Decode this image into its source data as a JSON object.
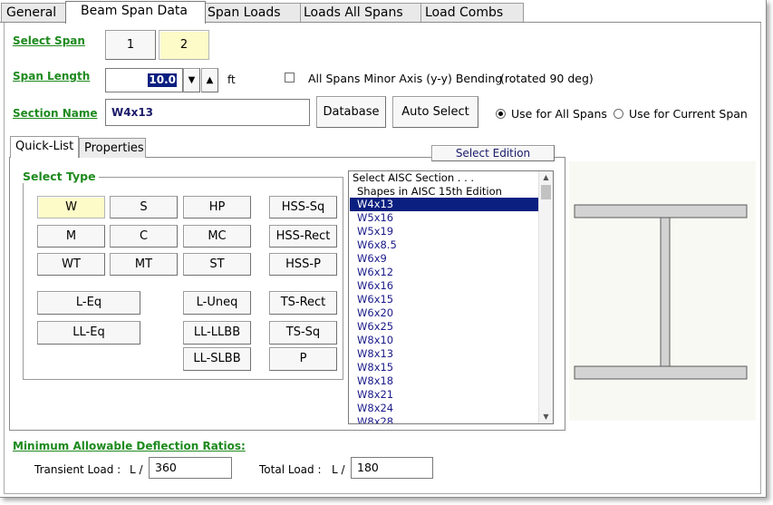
{
  "tabs": [
    {
      "label": "General"
    },
    {
      "label": "Beam Span Data"
    },
    {
      "label": "Span Loads"
    },
    {
      "label": "Loads All Spans"
    },
    {
      "label": "Load Combs"
    }
  ],
  "span": {
    "label": "Select Span",
    "buttons": [
      "1",
      "2"
    ],
    "selected": "2"
  },
  "span_length": {
    "label": "Span Length",
    "value": "10.0",
    "unit": "ft",
    "down_arrow": "▼",
    "up_arrow": "▲"
  },
  "minor_axis": {
    "label": "All Spans Minor Axis (y-y) Bending",
    "note": "(rotated 90 deg)",
    "checked": false
  },
  "section": {
    "label": "Section Name",
    "value": "W4x13",
    "database_label": "Database",
    "auto_select_label": "Auto Select",
    "radio_all": "Use for All Spans",
    "radio_current": "Use for Current Span",
    "radio_selected": "all"
  },
  "inner_tabs": [
    {
      "label": "Quick-List"
    },
    {
      "label": "Properties"
    }
  ],
  "select_edition_label": "Select Edition",
  "select_type": {
    "label": "Select Type",
    "buttons": {
      "W": "W",
      "S": "S",
      "HP": "HP",
      "HSSSq": "HSS-Sq",
      "M": "M",
      "C": "C",
      "MC": "MC",
      "HSSRect": "HSS-Rect",
      "WT": "WT",
      "MT": "MT",
      "ST": "ST",
      "HSSP": "HSS-P",
      "LEq": "L-Eq",
      "LUneq": "L-Uneq",
      "TSRect": "TS-Rect",
      "LLEq": "LL-Eq",
      "LLLLBB": "LL-LLBB",
      "TSSq": "TS-Sq",
      "LLSLBB": "LL-SLBB",
      "P": "P"
    },
    "selected": "W"
  },
  "section_list": {
    "items": [
      "Select AISC Section . . .",
      "Shapes in AISC 15th Edition",
      "W4x13",
      "W5x16",
      "W5x19",
      "W6x8.5",
      "W6x9",
      "W6x12",
      "W6x16",
      "W6x15",
      "W6x20",
      "W6x25",
      "W8x10",
      "W8x13",
      "W8x15",
      "W8x18",
      "W8x21",
      "W8x24",
      "W8x28"
    ],
    "selected": "W4x13",
    "scroll_up": "▲",
    "scroll_down": "▼"
  },
  "deflection": {
    "label": "Minimum Allowable Deflection Ratios:",
    "transient_label": "Transient Load :",
    "transient_prefix": "L /",
    "transient_value": "360",
    "total_label": "Total Load :",
    "total_prefix": "L /",
    "total_value": "180"
  },
  "colors": {
    "green_label": "#1e8a1e",
    "selected_yellow": "#fdfbc8",
    "list_selection": "#0a1f80",
    "list_text": "#1a1a8a",
    "shape_fill": "#d3d3d3"
  }
}
